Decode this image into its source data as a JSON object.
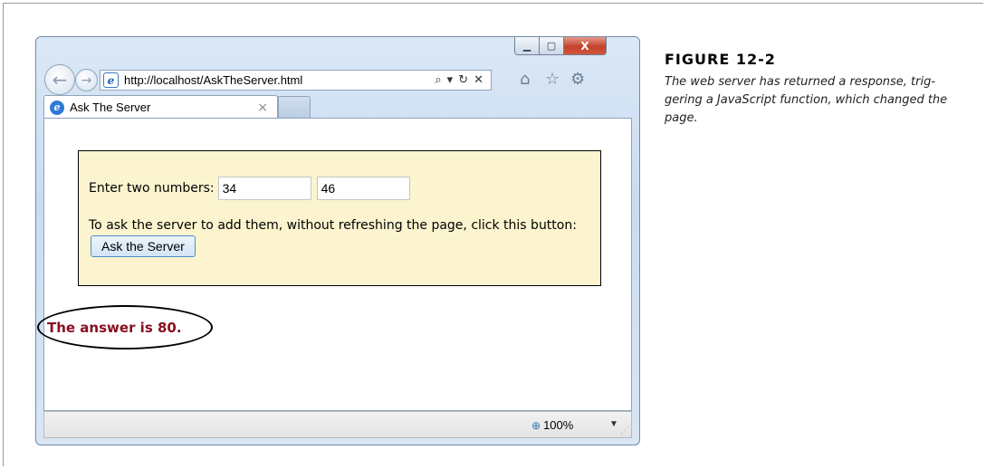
{
  "browser": {
    "url": "http://localhost/AskTheServer.html",
    "tab_title": "Ask The Server",
    "tab_close_glyph": "×",
    "window_buttons": {
      "minimize": "▁",
      "maximize": "▢",
      "close": "X"
    },
    "address_tools": {
      "search_glyph": "⌕",
      "dropdown_glyph": "▾",
      "refresh_glyph": "↻",
      "stop_glyph": "✕"
    },
    "toolbar_icons": {
      "home": "⌂",
      "favorites": "☆",
      "tools": "⚙"
    },
    "zoom_level": "100%",
    "zoom_icon": "⊕",
    "zoom_dropdown": "▼"
  },
  "page": {
    "prompt_label": "Enter two numbers:",
    "number1_value": "34",
    "number2_value": "46",
    "instruction_text": "To ask the server to add them, without refreshing the page, click this button:",
    "ask_button_label": "Ask the Server",
    "answer_text": "The answer is 80."
  },
  "caption": {
    "figure_label": "FIGURE 12-2",
    "text": "The web server has returned a response, trig- gering a JavaScript function, which changed the page."
  },
  "colors": {
    "answer": "#8b0e1e",
    "form_background": "#fbf4cf",
    "window_chrome": "#c9dcf1",
    "close_button": "#c4432c"
  }
}
